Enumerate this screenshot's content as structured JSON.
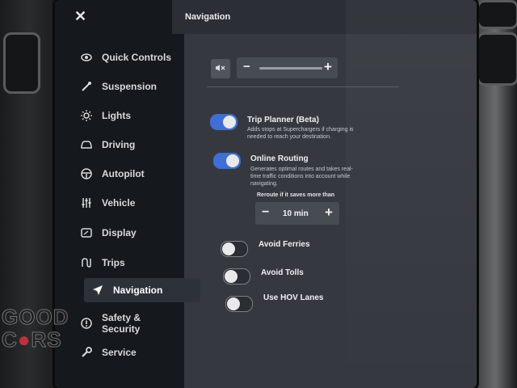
{
  "header": {
    "title": "Navigation"
  },
  "sidebar": {
    "items": [
      {
        "label": "Quick Controls",
        "icon": "eye-icon"
      },
      {
        "label": "Suspension",
        "icon": "suspension-icon"
      },
      {
        "label": "Lights",
        "icon": "sun-icon"
      },
      {
        "label": "Driving",
        "icon": "car-icon"
      },
      {
        "label": "Autopilot",
        "icon": "steering-wheel-icon"
      },
      {
        "label": "Vehicle",
        "icon": "sliders-icon"
      },
      {
        "label": "Display",
        "icon": "display-icon"
      },
      {
        "label": "Trips",
        "icon": "trips-icon"
      },
      {
        "label": "Navigation",
        "icon": "navigation-arrow-icon",
        "active": true
      },
      {
        "label_line1": "Safety &",
        "label_line2": "Security",
        "icon": "alert-icon"
      },
      {
        "label": "Service",
        "icon": "wrench-icon"
      }
    ]
  },
  "volume": {
    "minus": "−",
    "plus": "+",
    "level": 1.0
  },
  "options": {
    "trip_planner": {
      "title": "Trip Planner (Beta)",
      "desc1": "Adds stops at Superchargers if charging is",
      "desc2": "needed to reach your destination.",
      "enabled": true
    },
    "online_routing": {
      "title": "Online Routing",
      "desc1": "Generates optimal routes and takes real-",
      "desc2": "time traffic conditions into account while",
      "desc3": "navigating.",
      "enabled": true
    },
    "reroute": {
      "label": "Reroute if it saves more than",
      "value": "10 min",
      "minus": "−",
      "plus": "+"
    },
    "avoid_ferries": {
      "title": "Avoid Ferries",
      "enabled": false
    },
    "avoid_tolls": {
      "title": "Avoid Tolls",
      "enabled": false
    },
    "use_hov": {
      "title": "Use HOV Lanes",
      "enabled": false
    }
  },
  "watermark": {
    "line1": "GOOD",
    "line2a": "C",
    "line2b": "RS"
  },
  "colors": {
    "accent": "#3d6fd6",
    "sidebar_bg": "#15181c",
    "panel_bg": "#35393f"
  }
}
